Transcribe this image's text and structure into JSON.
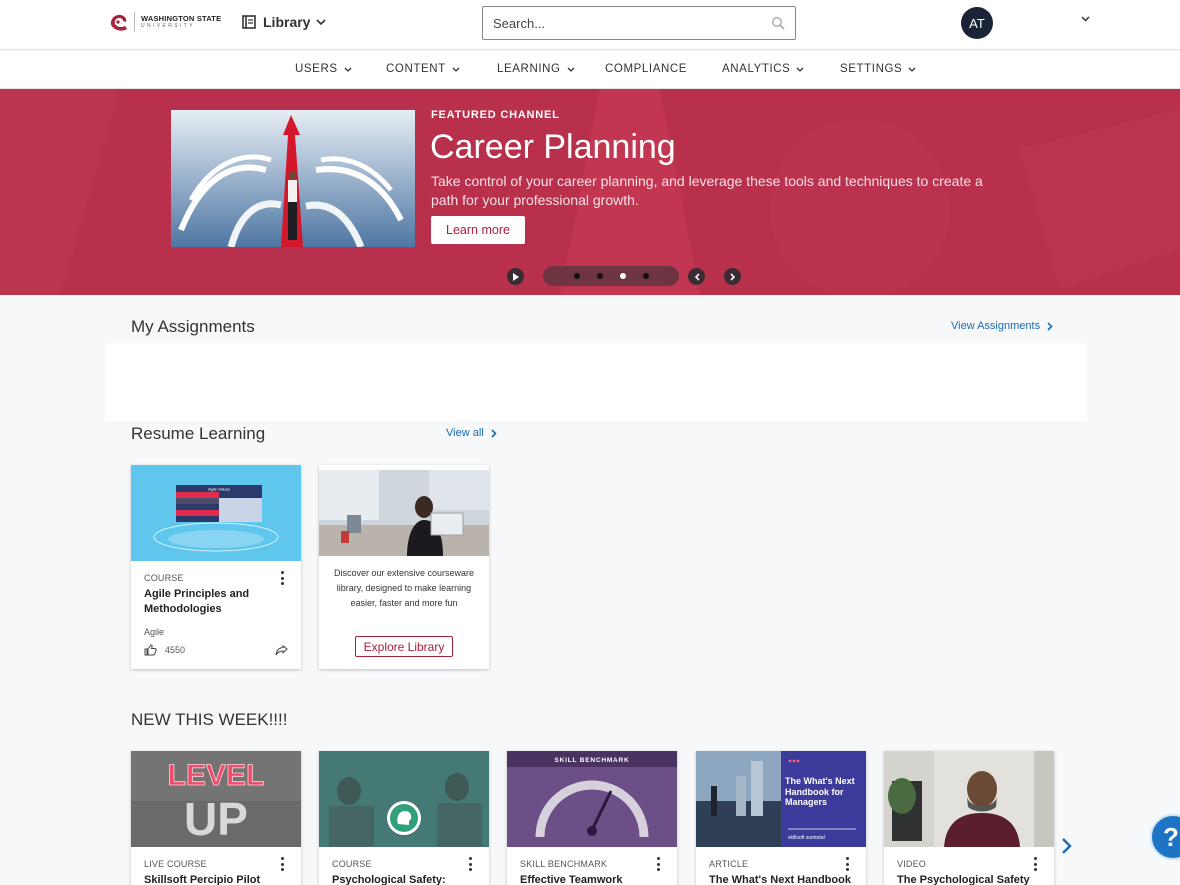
{
  "header": {
    "logo_line1": "WASHINGTON STATE",
    "logo_line2": "UNIVERSITY",
    "library_label": "Library",
    "search_placeholder": "Search...",
    "avatar_initials": "AT"
  },
  "nav": {
    "items": [
      {
        "label": "USERS",
        "has_menu": true
      },
      {
        "label": "CONTENT",
        "has_menu": true
      },
      {
        "label": "LEARNING",
        "has_menu": true
      },
      {
        "label": "COMPLIANCE",
        "has_menu": false
      },
      {
        "label": "ANALYTICS",
        "has_menu": true
      },
      {
        "label": "SETTINGS",
        "has_menu": true
      }
    ]
  },
  "hero": {
    "eyebrow": "FEATURED CHANNEL",
    "title": "Career Planning",
    "description": "Take control of your career planning, and leverage these tools and techniques to create a path for your professional growth.",
    "button_label": "Learn more",
    "slide_count": 4,
    "active_slide": 3,
    "bg_color": "#b8304c"
  },
  "assignments": {
    "title": "My Assignments",
    "view_link": "View Assignments"
  },
  "resume": {
    "title": "Resume Learning",
    "view_link": "View all",
    "course_card": {
      "type": "COURSE",
      "title": "Agile Principles and Methodologies",
      "tag": "Agile",
      "likes": "4550",
      "thumb_table_title": "Agile Values",
      "thumb_table_rows": [
        [
          "Individuals and interactions",
          "Processes and tools"
        ],
        [
          "Working software",
          "Comprehensive documentation"
        ],
        [
          "Customer collaboration",
          "Contract negotiation"
        ],
        [
          "Responding to change",
          "Following a plan"
        ]
      ]
    },
    "explore_card": {
      "description": "Discover our extensive courseware library, designed to make learning easier, faster and more fun",
      "button_label": "Explore Library"
    }
  },
  "new_this_week": {
    "title": "NEW THIS WEEK!!!!",
    "cards": [
      {
        "type": "LIVE COURSE",
        "title": "Skillsoft Percipio Pilot Group"
      },
      {
        "type": "COURSE",
        "title": "Psychological Safety:"
      },
      {
        "type": "SKILL BENCHMARK",
        "title": "Effective Teamwork"
      },
      {
        "type": "ARTICLE",
        "title": "The What's Next Handbook"
      },
      {
        "type": "VIDEO",
        "title": "The Psychological Safety"
      }
    ],
    "thumb_text": {
      "level": "LEVEL",
      "up": "UP",
      "benchmark_banner": "SKILL BENCHMARK",
      "handbook_title": "The What's Next Handbook for Managers",
      "handbook_brands": "skillsoft   sumtotal"
    }
  },
  "help_label": "?",
  "colors": {
    "brand": "#a8203a",
    "link": "#1a6bb0",
    "avatar_bg": "#1b2436"
  }
}
